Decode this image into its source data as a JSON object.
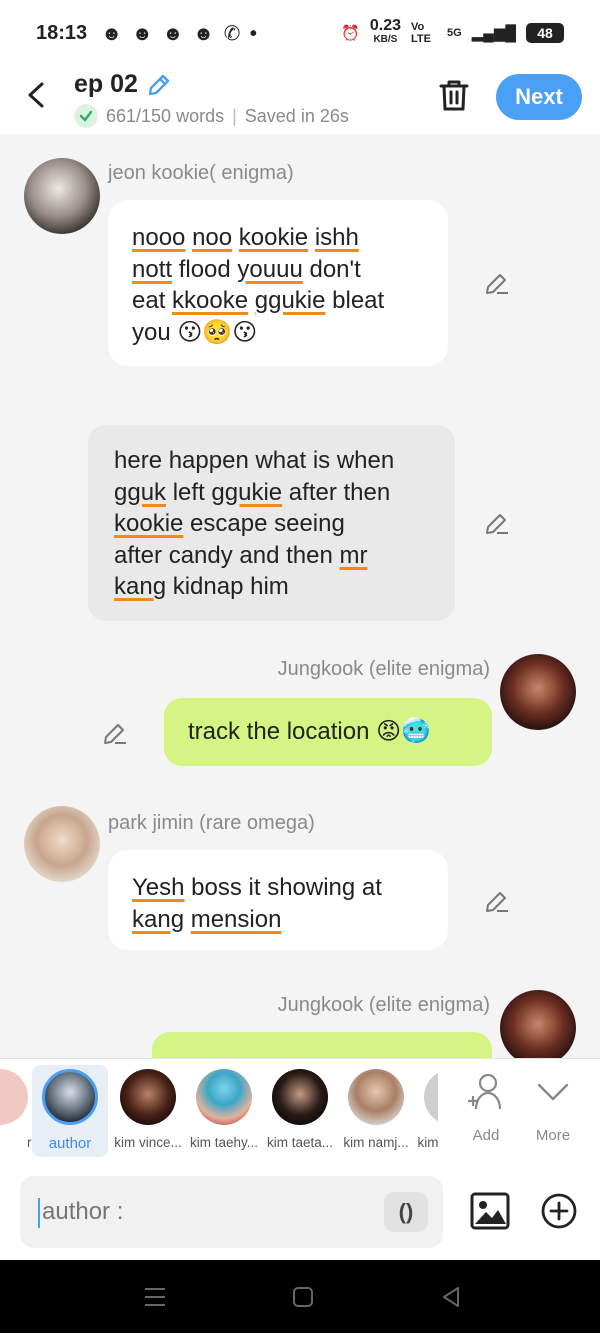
{
  "status_bar": {
    "time": "18:13",
    "notification_icons": "☻ ☻ ☻ ☻ ✆ •",
    "speed": "0.23",
    "speed_unit": "KB/S",
    "volte": "Vo LTE",
    "network": "5G",
    "battery": "48"
  },
  "header": {
    "title": "ep 02",
    "word_count": "661/150 words",
    "separator": "|",
    "saved": "Saved in 26s",
    "next_label": "Next"
  },
  "messages": [
    {
      "speaker": "jeon kookie( enigma)",
      "side": "left",
      "style": "white",
      "lines": [
        [
          {
            "t": "nooo",
            "u": true
          },
          {
            "t": " "
          },
          {
            "t": "noo",
            "u": true
          },
          {
            "t": " "
          },
          {
            "t": "kookie",
            "u": true
          },
          {
            "t": " "
          },
          {
            "t": "ishh",
            "u": true
          }
        ],
        [
          {
            "t": "nott",
            "u": true
          },
          {
            "t": " flood "
          },
          {
            "t": "youuu",
            "u": true
          },
          {
            "t": " don't"
          }
        ],
        [
          {
            "t": "eat "
          },
          {
            "t": "kkooke",
            "u": true
          },
          {
            "t": " "
          },
          {
            "t": "ggukie",
            "u": true
          },
          {
            "t": " bleat"
          }
        ],
        [
          {
            "t": "you 😗🥺😗"
          }
        ]
      ]
    },
    {
      "speaker": "",
      "side": "narration",
      "style": "grey",
      "lines": [
        [
          {
            "t": "here happen what is when"
          }
        ],
        [
          {
            "t": "gguk",
            "u": true
          },
          {
            "t": " left "
          },
          {
            "t": "ggukie",
            "u": true
          },
          {
            "t": " after then"
          }
        ],
        [
          {
            "t": "kookie",
            "u": true
          },
          {
            "t": " escape seeing"
          }
        ],
        [
          {
            "t": "after candy and then "
          },
          {
            "t": "mr",
            "u": true
          }
        ],
        [
          {
            "t": "kang",
            "u": true
          },
          {
            "t": " kidnap him"
          }
        ]
      ]
    },
    {
      "speaker": "Jungkook (elite enigma)",
      "side": "right",
      "style": "green",
      "lines": [
        [
          {
            "t": "track the location 😡🥶"
          }
        ]
      ]
    },
    {
      "speaker": "park jimin (rare omega)",
      "side": "left",
      "style": "white",
      "lines": [
        [
          {
            "t": "Yesh",
            "u": true
          },
          {
            "t": " boss it showing at"
          }
        ],
        [
          {
            "t": "kang",
            "u": true
          },
          {
            "t": " "
          },
          {
            "t": "mension",
            "u": true
          }
        ]
      ]
    },
    {
      "speaker": "Jungkook (elite enigma)",
      "side": "right",
      "style": "green",
      "lines": []
    }
  ],
  "characters": [
    {
      "name": "r...",
      "selected": false
    },
    {
      "name": "author",
      "selected": true
    },
    {
      "name": "kim vince...",
      "selected": false
    },
    {
      "name": "kim taehy...",
      "selected": false
    },
    {
      "name": "kim taeta...",
      "selected": false
    },
    {
      "name": "kim namj...",
      "selected": false
    },
    {
      "name": "kim",
      "selected": false
    }
  ],
  "tools": {
    "add_label": "Add",
    "more_label": "More"
  },
  "input": {
    "placeholder": "author :",
    "paren_label": "()"
  },
  "colors": {
    "accent": "#4aa0f4",
    "green_bubble": "#d4f484",
    "spell_underline": "#f08a1c"
  }
}
